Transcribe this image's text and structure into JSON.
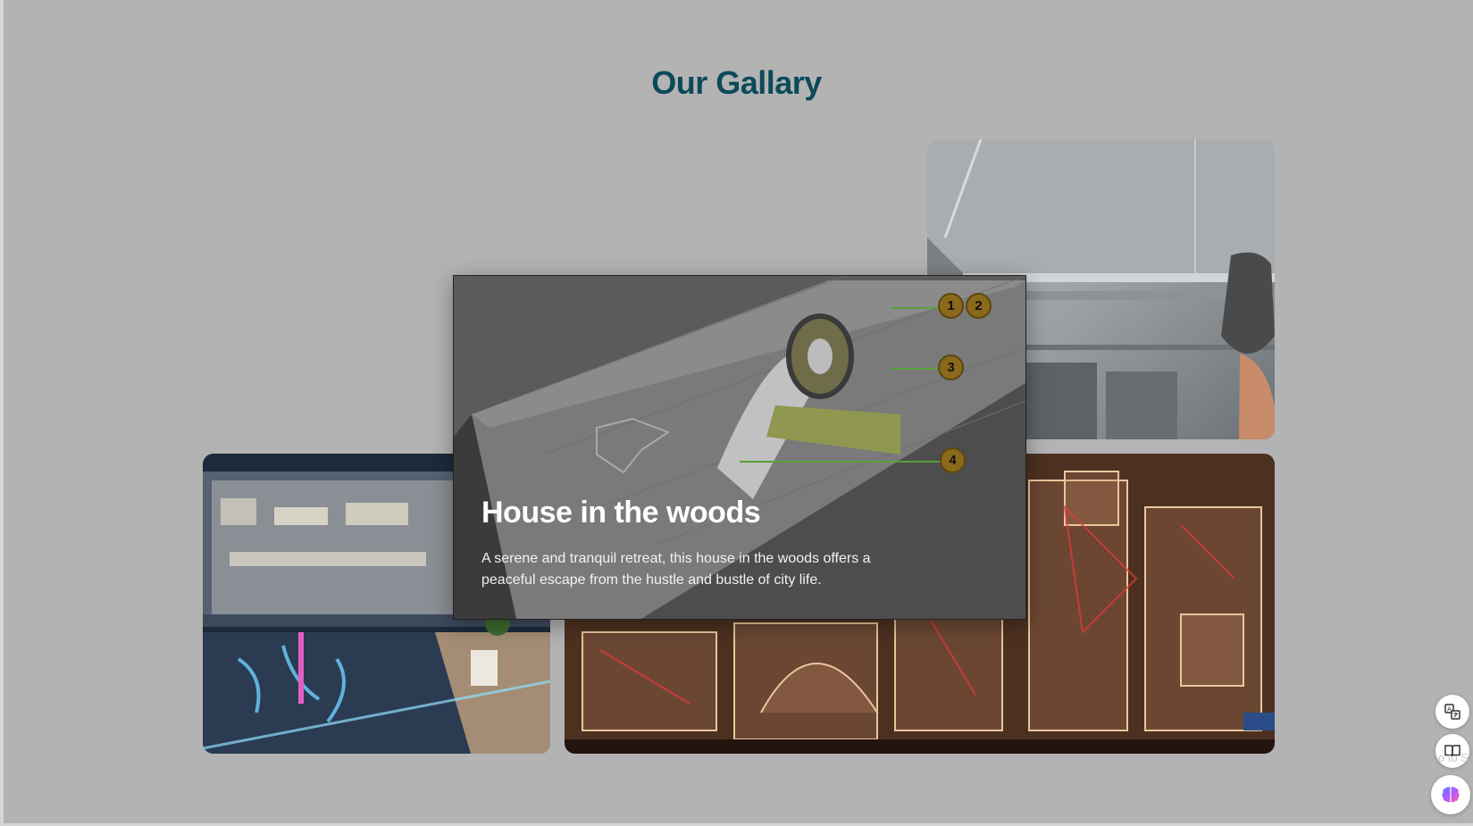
{
  "gallery": {
    "title": "Our Gallary",
    "images": [
      {
        "name": "duct-installation",
        "description": "metal duct ceiling with gloved hand"
      },
      {
        "name": "office-building-cutaway",
        "description": "cutaway office building with glowing pipes"
      },
      {
        "name": "transparent-machine-model",
        "description": "transparent acrylic machinery model"
      }
    ]
  },
  "modal": {
    "title": "House in the woods",
    "description": "A serene and tranquil retreat, this house in the woods offers a peaceful escape from the hustle and bustle of city life.",
    "hotspots": [
      "1",
      "2",
      "3",
      "4"
    ],
    "hotspot_color": "#8a6a1a"
  },
  "floating_tools": [
    {
      "name": "translate-icon"
    },
    {
      "name": "reader-icon"
    },
    {
      "name": "brain-icon"
    }
  ],
  "faint_text": "o to S",
  "colors": {
    "background": "#b3b3b3",
    "title": "#0c4a5a"
  }
}
